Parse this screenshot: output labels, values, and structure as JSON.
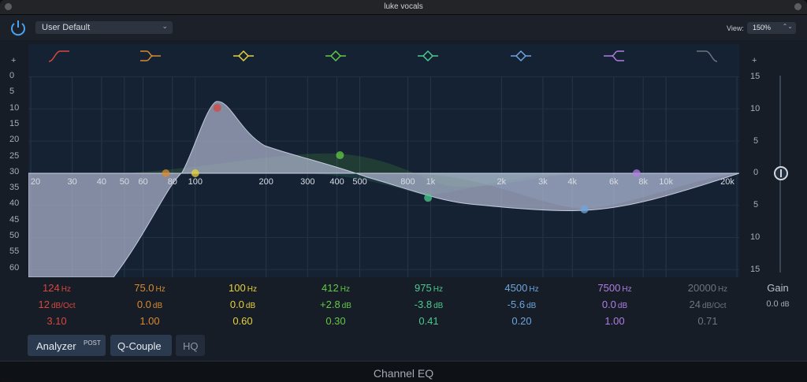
{
  "window": {
    "title": "luke vocals",
    "footer_label": "Channel EQ"
  },
  "toolbar": {
    "power_state": "on",
    "preset": "User Default",
    "view_label": "View:",
    "view_value": "150%"
  },
  "left_scale": {
    "plus": "+",
    "labels": [
      "0",
      "5",
      "10",
      "15",
      "20",
      "25",
      "30",
      "35",
      "40",
      "45",
      "50",
      "55",
      "60"
    ]
  },
  "right_scale": {
    "plus": "+",
    "labels": [
      "15",
      "10",
      "5",
      "0",
      "5",
      "10",
      "15"
    ]
  },
  "freq_labels": [
    "20",
    "30",
    "40",
    "50",
    "60",
    "80",
    "100",
    "200",
    "300",
    "400",
    "500",
    "800",
    "1k",
    "2k",
    "3k",
    "4k",
    "6k",
    "8k",
    "10k",
    "20k"
  ],
  "bands": [
    {
      "name": "low-cut",
      "color": "#d9463f",
      "freq": "124",
      "freq_unit": "Hz",
      "gain": "12",
      "gain_unit": "dB/Oct",
      "q": "3.10"
    },
    {
      "name": "low-shelf",
      "color": "#d98a2f",
      "freq": "75.0",
      "freq_unit": "Hz",
      "gain": "0.0",
      "gain_unit": "dB",
      "q": "1.00"
    },
    {
      "name": "parametric-1",
      "color": "#e6d23c",
      "freq": "100",
      "freq_unit": "Hz",
      "gain": "0.0",
      "gain_unit": "dB",
      "q": "0.60"
    },
    {
      "name": "parametric-2",
      "color": "#63c846",
      "freq": "412",
      "freq_unit": "Hz",
      "gain": "+2.8",
      "gain_unit": "dB",
      "q": "0.30"
    },
    {
      "name": "parametric-3",
      "color": "#4dc98d",
      "freq": "975",
      "freq_unit": "Hz",
      "gain": "-3.8",
      "gain_unit": "dB",
      "q": "0.41"
    },
    {
      "name": "parametric-4",
      "color": "#6ea5de",
      "freq": "4500",
      "freq_unit": "Hz",
      "gain": "-5.6",
      "gain_unit": "dB",
      "q": "0.20"
    },
    {
      "name": "high-shelf",
      "color": "#b07ee0",
      "freq": "7500",
      "freq_unit": "Hz",
      "gain": "0.0",
      "gain_unit": "dB",
      "q": "1.00"
    },
    {
      "name": "high-cut",
      "color": "#6d7480",
      "freq": "20000",
      "freq_unit": "Hz",
      "gain": "24",
      "gain_unit": "dB/Oct",
      "q": "0.71"
    }
  ],
  "gain": {
    "label": "Gain",
    "value": "0.0",
    "unit": "dB"
  },
  "buttons": {
    "analyzer": "Analyzer",
    "analyzer_mode": "POST",
    "q_couple": "Q-Couple",
    "hq": "HQ"
  }
}
